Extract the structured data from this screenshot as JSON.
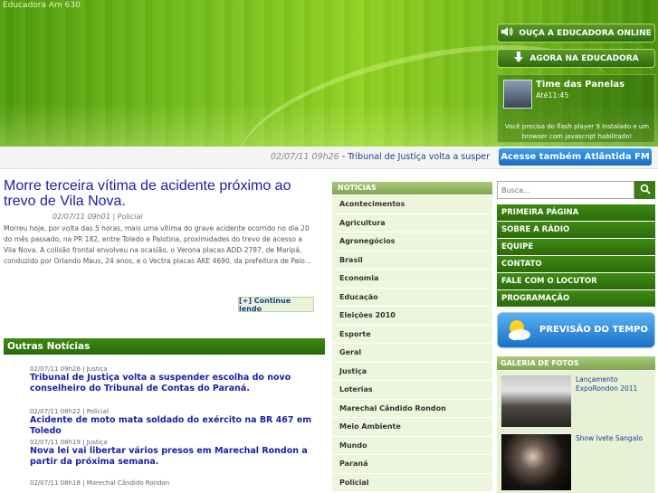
{
  "header": {
    "site_name": "Educadora Am 630",
    "listen_button": "OUÇA A EDUCADORA ONLINE",
    "now_button": "AGORA NA EDUCADORA",
    "show": {
      "title": "Time das Panelas",
      "time": "Até11:45"
    },
    "flash_note": "Você precisa do flash player 9 instalado e um browser com javascript habilitado!"
  },
  "ticker": {
    "time": "02/07/11 09h26",
    "separator": " - ",
    "text": "Tribunal de Justiça volta a susper",
    "atlantida_button": "Acesse também Atlântida FM"
  },
  "headline": {
    "title": "Morre terceira vítima de acidente próximo ao trevo de Vila Nova.",
    "meta": "02/07/11 09h01 | Policial",
    "body": "Morreu hoje, por volta das 5 horas, mais uma vítima do grave acidente ocorrido no dia 20 do mês passado, na PR 182, entre Toledo e Palotina, proximidades do trevo de acesso a Vila Nova. A colisão frontal envolveu na ocasião, o Verona placas ADD-2787, de Maripá, conduzido por Orlando Maus, 24 anos, e o Vectra placas AKE 4690, da prefeitura de Palo...",
    "continue": "[+] Continue lendo"
  },
  "outras": {
    "title": "Outras Notícias",
    "items": [
      {
        "meta": "02/07/11 09h26 | Justiça",
        "title": "Tribunal de Justiça volta a suspender escolha do novo conselheiro do Tribunal de Contas do Paraná."
      },
      {
        "meta": "02/07/11 08h22 | Policial",
        "title": "Acidente de moto mata soldado do exército na BR 467 em Toledo"
      },
      {
        "meta": "02/07/11 08h19 | Justiça",
        "title": "Nova lei vai libertar vários presos em Marechal Rondon a partir da próxima semana."
      },
      {
        "meta": "02/07/11 08h18 | Marechal Cândido Rondon",
        "title": ""
      }
    ]
  },
  "categories": {
    "header": "NOTÍCIAS",
    "items": [
      "Acontecimentos",
      "Agricultura",
      "Agronegócios",
      "Brasil",
      "Economia",
      "Educação",
      "Eleições 2010",
      "Esporte",
      "Geral",
      "Justiça",
      "Loterias",
      "Marechal Cândido Rondon",
      "Meio Ambiente",
      "Mundo",
      "Paraná",
      "Policial"
    ]
  },
  "search": {
    "placeholder": "Busca..."
  },
  "nav": {
    "items": [
      "PRIMEIRA PÁGINA",
      "SOBRE A RÁDIO",
      "EQUIPE",
      "CONTATO",
      "FALE COM O LOCUTOR",
      "PROGRAMAÇÃO"
    ]
  },
  "weather": {
    "label": "PREVISÃO DO TEMPO"
  },
  "gallery": {
    "header": "GALERIA DE FOTOS",
    "items": [
      {
        "caption": "Lançamento ExpoRondon 2011"
      },
      {
        "caption": "Show Ivete Sangalo"
      }
    ]
  },
  "colors": {
    "brand_green": "#3c8a12",
    "link_blue": "#1a1fa8",
    "accent_blue": "#1b6cc2"
  }
}
